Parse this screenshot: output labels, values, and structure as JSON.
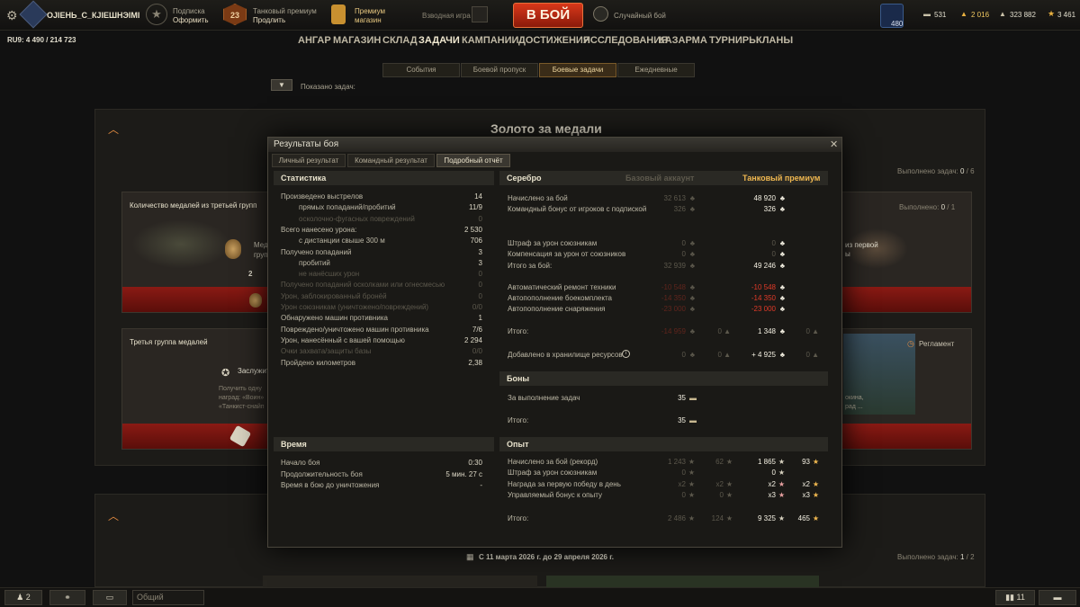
{
  "topbar": {
    "player_name": "ОJIEНЬ_С_КJIEШНЭIMI",
    "subscription_label": "Подписка",
    "subscription_action": "Оформить",
    "premium_label": "Танковый премиум",
    "premium_action": "Продлить",
    "premium_days": "23",
    "shop_label_1": "Премиум",
    "shop_label_2": "магазин",
    "platoon_label": "Взводная игра",
    "battle_button": "В БОЙ",
    "battle_mode": "Случайный бой",
    "free_xp": "480",
    "currency_bonds": "531",
    "currency_gold": "2 016",
    "currency_silver": "323 882",
    "currency_xp": "3 461",
    "server": "RU9: 4 490 / 214 723"
  },
  "nav": {
    "items": [
      "АНГАР",
      "МАГАЗИН",
      "СКЛАД",
      "ЗАДАЧИ",
      "КАМПАНИИ",
      "ДОСТИЖЕНИЯ",
      "ИССЛЕДОВАНИЯ",
      "КАЗАРМА",
      "ТУРНИРЫ",
      "КЛАНЫ"
    ]
  },
  "subtabs": [
    "События",
    "Боевой пропуск",
    "Боевые задачи",
    "Ежедневные"
  ],
  "filter": {
    "label": "Показано задач:"
  },
  "background": {
    "section_title": "Золото за медали",
    "done_label_1": "Выполнено задач:",
    "done_value_1": "0",
    "done_total_1": "6",
    "card1_title": "Количество медалей из третьей групп",
    "card1_text": "Мед групп",
    "card1_count": "2",
    "card1_done_label": "Выполнено:",
    "card1_done_value": "0",
    "card1_done_total": "1",
    "card1_right_text_1": "из первой",
    "card1_right_text_2": "ы",
    "card2_title": "Третья группа медалей",
    "card2_sub": "Заслужит",
    "card2_text_1": "Получить одну",
    "card2_text_2": "наград: «Воин»",
    "card2_text_3": "«Танкист-снайп",
    "card2_right_text_1": "окина,",
    "card2_right_text_2": "рад ...",
    "card2_right_reglament": "Регламент",
    "date_range": "С 11 марта 2026 г. до 29 апреля 2026 г.",
    "done_label_2": "Выполнено задач:",
    "done_value_2": "1",
    "done_total_2": "2"
  },
  "dialog": {
    "title": "Результаты боя",
    "tabs": [
      "Личный результат",
      "Командный результат",
      "Подробный отчёт"
    ],
    "stats_title": "Статистика",
    "stats": [
      {
        "label": "Произведено выстрелов",
        "value": "14",
        "indent": false,
        "dim": false
      },
      {
        "label": "прямых попаданий/пробитий",
        "value": "11/9",
        "indent": true,
        "dim": false
      },
      {
        "label": "осколочно-фугасных повреждений",
        "value": "0",
        "indent": true,
        "dim": true
      },
      {
        "label": "Всего нанесено урона:",
        "value": "2 530",
        "indent": false,
        "dim": false
      },
      {
        "label": "с дистанции свыше 300 м",
        "value": "706",
        "indent": true,
        "dim": false
      },
      {
        "label": "Получено попаданий",
        "value": "3",
        "indent": false,
        "dim": false
      },
      {
        "label": "пробитий",
        "value": "3",
        "indent": true,
        "dim": false
      },
      {
        "label": "не нанёсших урон",
        "value": "0",
        "indent": true,
        "dim": true
      },
      {
        "label": "Получено попаданий осколками или огнесмесью",
        "value": "0",
        "indent": false,
        "dim": true
      },
      {
        "label": "Урон, заблокированный бронёй",
        "value": "0",
        "indent": false,
        "dim": true
      },
      {
        "label": "Урон союзникам (уничтожено/повреждений)",
        "value": "0/0",
        "indent": false,
        "dim": true
      },
      {
        "label": "Обнаружено машин противника",
        "value": "1",
        "indent": false,
        "dim": false
      },
      {
        "label": "Повреждено/уничтожено машин противника",
        "value": "7/6",
        "indent": false,
        "dim": false
      },
      {
        "label": "Урон, нанесённый с вашей помощью",
        "value": "2 294",
        "indent": false,
        "dim": false
      },
      {
        "label": "Очки захвата/защиты базы",
        "value": "0/0",
        "indent": false,
        "dim": true
      },
      {
        "label": "Пройдено километров",
        "value": "2,38",
        "indent": false,
        "dim": false
      }
    ],
    "time_title": "Время",
    "time": [
      {
        "label": "Начало боя",
        "value": "0:30"
      },
      {
        "label": "Продолжительность боя",
        "value": "5 мин. 27 с"
      },
      {
        "label": "Время в бою до уничтожения",
        "value": "-"
      }
    ],
    "silver_title": "Серебро",
    "base_account": "Базовый аккаунт",
    "tank_premium": "Танковый премиум",
    "silver": [
      {
        "label": "Начислено за бой",
        "base": "32 613",
        "prem": "48 920",
        "red": false,
        "base_red": false
      },
      {
        "label": "Командный бонус от игроков с подпиской",
        "base": "326",
        "prem": "326",
        "red": false,
        "base_red": false
      },
      {
        "label": "Штраф за урон союзникам",
        "base": "0",
        "prem": "0",
        "red": false,
        "dim": true,
        "base_red": false
      },
      {
        "label": "Компенсация за урон от союзников",
        "base": "0",
        "prem": "0",
        "red": false,
        "dim": true,
        "base_red": false
      },
      {
        "label": "Итого за бой:",
        "base": "32 939",
        "prem": "49 246",
        "red": false,
        "base_red": false
      },
      {
        "label": "Автоматический ремонт техники",
        "base": "-10 548",
        "prem": "-10 548",
        "red": true,
        "base_red": true
      },
      {
        "label": "Автопополнение боекомплекта",
        "base": "-14 350",
        "prem": "-14 350",
        "red": true,
        "base_red": true
      },
      {
        "label": "Автопополнение снаряжения",
        "base": "-23 000",
        "prem": "-23 000",
        "red": true,
        "base_red": true
      },
      {
        "label": "Итого:",
        "base": "-14 959",
        "prem": "1 348",
        "red": false,
        "base_red": true,
        "base_extra": "0",
        "prem_extra": "0"
      },
      {
        "label": "Добавлено в хранилище ресурсов",
        "base": "0",
        "prem": "+ 4 925",
        "red": false,
        "base_red": false,
        "base_extra": "0",
        "prem_extra": "0"
      }
    ],
    "bonds_title": "Боны",
    "bonds": [
      {
        "label": "За выполнение задач",
        "value": "35"
      },
      {
        "label": "Итого:",
        "value": "35"
      }
    ],
    "xp_title": "Опыт",
    "xp": [
      {
        "label": "Начислено за бой (рекорд)",
        "base": "1 243",
        "base2": "62",
        "prem": "1 865",
        "prem2": "93"
      },
      {
        "label": "Штраф за урон союзникам",
        "base": "0",
        "base2": "",
        "prem": "0",
        "prem2": ""
      },
      {
        "label": "Награда за первую победу в день",
        "base": "x2",
        "base2": "x2",
        "prem": "x2",
        "prem2": "x2"
      },
      {
        "label": "Управляемый бонус к опыту",
        "base": "0",
        "base2": "0",
        "prem": "x3",
        "prem2": "x3"
      },
      {
        "label": "Итого:",
        "base": "2 486",
        "base2": "124",
        "prem": "9 325",
        "prem2": "465"
      }
    ]
  },
  "bottombar": {
    "friends": "2",
    "chat_placeholder": "Общий",
    "notifications": "11"
  }
}
